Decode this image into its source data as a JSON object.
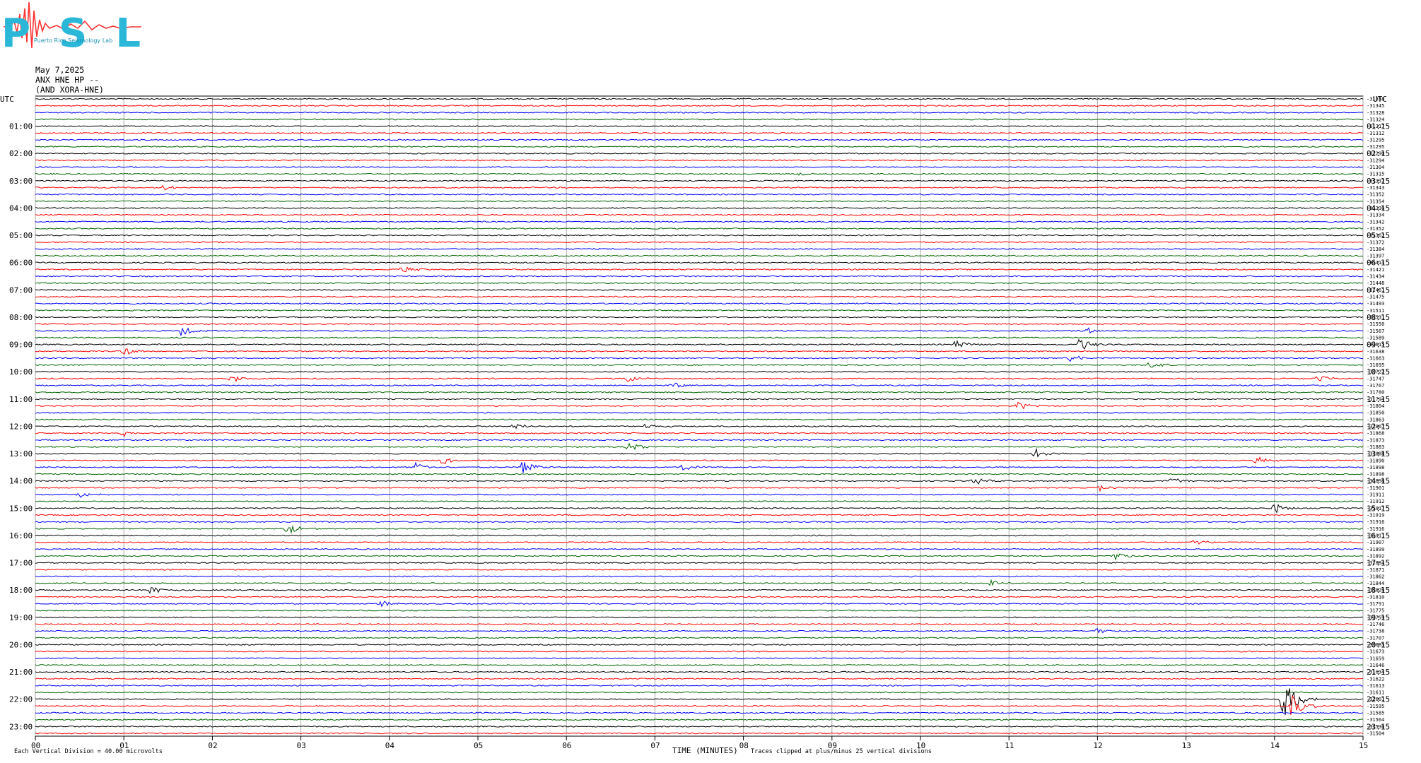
{
  "header": {
    "date": "May 7,2025",
    "station": "ANX HNE HP --",
    "network": "(AND XORA-HNE)",
    "utc_left": "UTC",
    "utc_right": "UTC"
  },
  "logo": {
    "letters": "PSL",
    "caption": "Puerto Rico Seismology Lab",
    "colors": {
      "letters": "#2ab7d8",
      "trace": "#ff3333"
    }
  },
  "footer": {
    "scale_note": "Each Vertical Division =   40.00 microvolts",
    "time_label": "TIME (MINUTES)",
    "clip_note": "Traces clipped at plus/minus 25 vertical divisions"
  },
  "chart_data": {
    "type": "line",
    "subtype": "helicorder",
    "xlabel": "TIME (MINUTES)",
    "xlim": [
      0,
      15
    ],
    "x_ticks": [
      "00",
      "01",
      "02",
      "03",
      "04",
      "05",
      "06",
      "07",
      "08",
      "09",
      "10",
      "11",
      "12",
      "13",
      "14",
      "15"
    ],
    "trace_minutes": 15,
    "trace_colors": [
      "#000000",
      "#ff0000",
      "#0000ff",
      "#006400"
    ],
    "grid": true,
    "left_hour_labels": [
      "01:00",
      "02:00",
      "03:00",
      "04:00",
      "05:00",
      "06:00",
      "07:00",
      "08:00",
      "09:00",
      "10:00",
      "11:00",
      "12:00",
      "13:00",
      "14:00",
      "15:00",
      "16:00",
      "17:00",
      "18:00",
      "19:00",
      "20:00",
      "21:00",
      "22:00",
      "23:00"
    ],
    "right_hour_labels": [
      "01:15",
      "02:15",
      "03:15",
      "04:15",
      "05:15",
      "06:15",
      "07:15",
      "08:15",
      "09:15",
      "10:15",
      "11:15",
      "12:15",
      "13:15",
      "14:15",
      "15:15",
      "16:15",
      "17:15",
      "18:15",
      "19:15",
      "20:15",
      "21:15",
      "22:15",
      "23:15"
    ],
    "trace_offsets": [
      "-31358",
      "-31345",
      "-31328",
      "-31324",
      "-31317",
      "-31312",
      "-31295",
      "-31295",
      "-31290",
      "-31294",
      "-31304",
      "-31315",
      "-31332",
      "-31343",
      "-31352",
      "-31354",
      "-31336",
      "-31334",
      "-31342",
      "-31352",
      "-31362",
      "-31372",
      "-31384",
      "-31397",
      "-31414",
      "-31421",
      "-31434",
      "-31448",
      "-31461",
      "-31475",
      "-31493",
      "-31511",
      "-31531",
      "-31550",
      "-31567",
      "-31589",
      "-31615",
      "-31638",
      "-31663",
      "-31695",
      "-31722",
      "-31747",
      "-31767",
      "-31780",
      "-31794",
      "-31804",
      "-31850",
      "-31863",
      "-31867",
      "-31868",
      "-31873",
      "-31883",
      "-31888",
      "-31890",
      "-31898",
      "-31898",
      "-31898",
      "-31901",
      "-31911",
      "-31912",
      "-31917",
      "-31919",
      "-31916",
      "-31916",
      "-31911",
      "-31907",
      "-31899",
      "-31892",
      "-31884",
      "-31871",
      "-31862",
      "-31844",
      "-31826",
      "-31810",
      "-31791",
      "-31775",
      "-31759",
      "-31746",
      "-31738",
      "-31707",
      "-31685",
      "-31673",
      "-31659",
      "-31646",
      "-31634",
      "-31622",
      "-31613",
      "-31611",
      "-31601",
      "-31595",
      "-31585",
      "-31564",
      "-31536",
      "-31504"
    ],
    "events": [
      {
        "trace": 45,
        "minute": 11.1,
        "amp": 7
      },
      {
        "trace": 25,
        "minute": 4.15,
        "amp": 6
      },
      {
        "trace": 11,
        "minute": 8.65,
        "amp": 4
      },
      {
        "trace": 13,
        "minute": 1.45,
        "amp": 4
      },
      {
        "trace": 34,
        "minute": 1.65,
        "amp": 8
      },
      {
        "trace": 34,
        "minute": 11.85,
        "amp": 6
      },
      {
        "trace": 36,
        "minute": 10.4,
        "amp": 6
      },
      {
        "trace": 36,
        "minute": 11.8,
        "amp": 10
      },
      {
        "trace": 37,
        "minute": 1.0,
        "amp": 6
      },
      {
        "trace": 38,
        "minute": 11.7,
        "amp": 6
      },
      {
        "trace": 39,
        "minute": 12.6,
        "amp": 6
      },
      {
        "trace": 41,
        "minute": 2.2,
        "amp": 6
      },
      {
        "trace": 41,
        "minute": 14.5,
        "amp": 6
      },
      {
        "trace": 41,
        "minute": 6.7,
        "amp": 5
      },
      {
        "trace": 42,
        "minute": 7.2,
        "amp": 6
      },
      {
        "trace": 48,
        "minute": 5.4,
        "amp": 5
      },
      {
        "trace": 48,
        "minute": 6.9,
        "amp": 5
      },
      {
        "trace": 49,
        "minute": 1.0,
        "amp": 5
      },
      {
        "trace": 51,
        "minute": 6.7,
        "amp": 7
      },
      {
        "trace": 52,
        "minute": 11.3,
        "amp": 7
      },
      {
        "trace": 53,
        "minute": 4.6,
        "amp": 6
      },
      {
        "trace": 53,
        "minute": 13.8,
        "amp": 6
      },
      {
        "trace": 54,
        "minute": 4.3,
        "amp": 7
      },
      {
        "trace": 54,
        "minute": 5.5,
        "amp": 14
      },
      {
        "trace": 54,
        "minute": 7.3,
        "amp": 6
      },
      {
        "trace": 56,
        "minute": 10.6,
        "amp": 6
      },
      {
        "trace": 56,
        "minute": 12.8,
        "amp": 8
      },
      {
        "trace": 57,
        "minute": 12.0,
        "amp": 6
      },
      {
        "trace": 58,
        "minute": 0.5,
        "amp": 5
      },
      {
        "trace": 60,
        "minute": 14.0,
        "amp": 7
      },
      {
        "trace": 63,
        "minute": 2.85,
        "amp": 9
      },
      {
        "trace": 65,
        "minute": 13.1,
        "amp": 6
      },
      {
        "trace": 67,
        "minute": 12.2,
        "amp": 7
      },
      {
        "trace": 71,
        "minute": 10.8,
        "amp": 5
      },
      {
        "trace": 72,
        "minute": 1.3,
        "amp": 6
      },
      {
        "trace": 74,
        "minute": 3.9,
        "amp": 5
      },
      {
        "trace": 78,
        "minute": 12.0,
        "amp": 5
      },
      {
        "trace": 88,
        "minute": 14.1,
        "amp": 38
      },
      {
        "trace": 89,
        "minute": 14.2,
        "amp": 18
      }
    ]
  }
}
